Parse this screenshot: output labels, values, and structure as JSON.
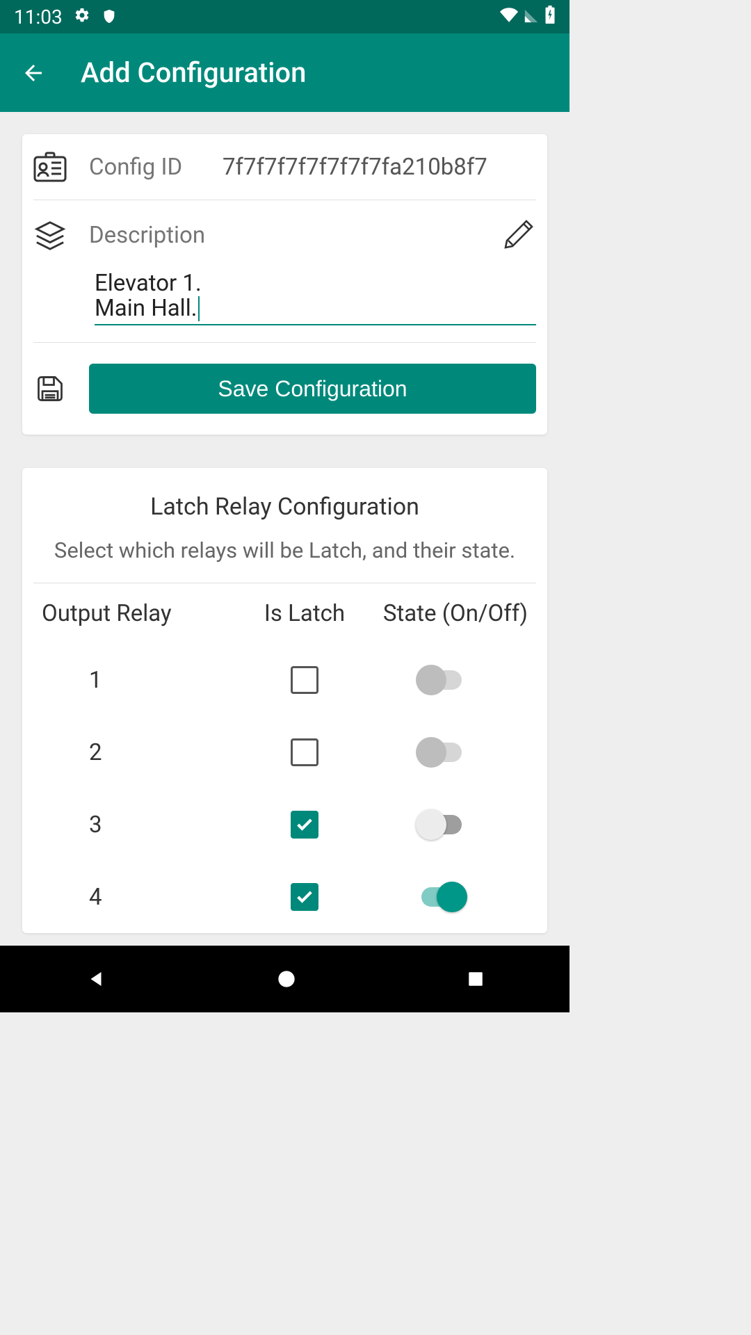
{
  "status": {
    "time": "11:03"
  },
  "header": {
    "title": "Add Configuration"
  },
  "config": {
    "id_label": "Config ID",
    "id_value": "7f7f7f7f7f7f7f7fa210b8f7",
    "desc_label": "Description",
    "desc_value": "Elevator 1.\nMain Hall.",
    "save_label": "Save Configuration"
  },
  "latch": {
    "title": "Latch Relay Configuration",
    "subtitle": "Select which relays will be Latch, and their state.",
    "col_relay": "Output Relay",
    "col_latch": "Is Latch",
    "col_state": "State (On/Off)",
    "rows": [
      {
        "relay": "1",
        "is_latch": false,
        "state_on": false,
        "enabled": false
      },
      {
        "relay": "2",
        "is_latch": false,
        "state_on": false,
        "enabled": false
      },
      {
        "relay": "3",
        "is_latch": true,
        "state_on": false,
        "enabled": true
      },
      {
        "relay": "4",
        "is_latch": true,
        "state_on": true,
        "enabled": true
      }
    ]
  }
}
